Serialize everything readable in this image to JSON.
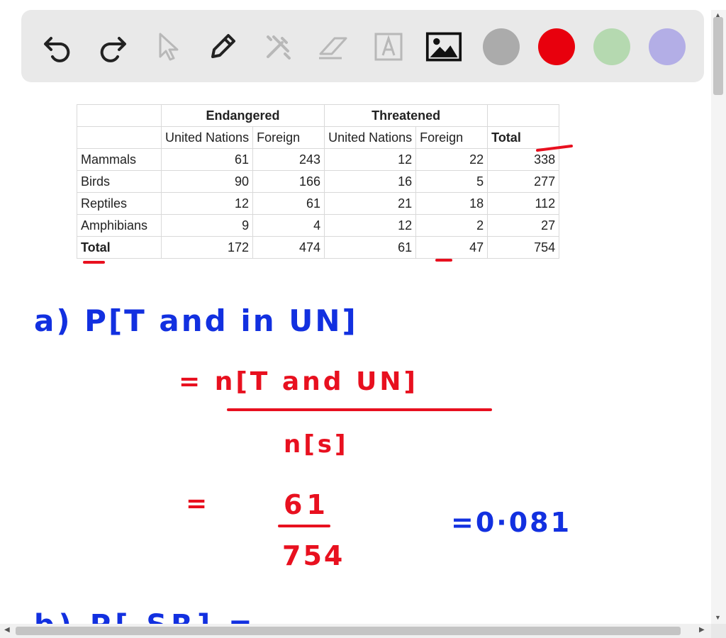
{
  "toolbar": {
    "tools": [
      {
        "name": "undo-icon",
        "active": true
      },
      {
        "name": "redo-icon",
        "active": true
      },
      {
        "name": "pointer-icon",
        "active": false
      },
      {
        "name": "pen-icon",
        "active": true
      },
      {
        "name": "tools-icon",
        "active": false
      },
      {
        "name": "eraser-icon",
        "active": false
      },
      {
        "name": "text-icon",
        "active": false
      },
      {
        "name": "image-icon",
        "active": true
      }
    ],
    "colors": [
      "#ababab",
      "#e8000d",
      "#b5d9b0",
      "#b3aee6"
    ]
  },
  "table": {
    "group_headers": [
      "Endangered",
      "Threatened"
    ],
    "sub_headers": [
      "United Nations",
      "Foreign",
      "United Nations",
      "Foreign",
      "Total"
    ],
    "rows": [
      {
        "label": "Mammals",
        "values": [
          "61",
          "243",
          "12",
          "22",
          "338"
        ]
      },
      {
        "label": "Birds",
        "values": [
          "90",
          "166",
          "16",
          "5",
          "277"
        ]
      },
      {
        "label": "Reptiles",
        "values": [
          "12",
          "61",
          "21",
          "18",
          "112"
        ]
      },
      {
        "label": "Amphibians",
        "values": [
          "9",
          "4",
          "12",
          "2",
          "27"
        ]
      },
      {
        "label": "Total",
        "values": [
          "172",
          "474",
          "61",
          "47",
          "754"
        ]
      }
    ]
  },
  "handwriting": {
    "part_a_question": "a) P[T and in UN]",
    "formula_numerator": "= n[T and UN]",
    "formula_denominator": "n[s]",
    "equals": "=",
    "fraction_numerator": "61",
    "fraction_denominator": "754",
    "result": "=0·081",
    "part_b_partial": "b) P[ SR] ="
  },
  "ink_colors": {
    "blue": "#1230e0",
    "red": "#e8101f"
  }
}
